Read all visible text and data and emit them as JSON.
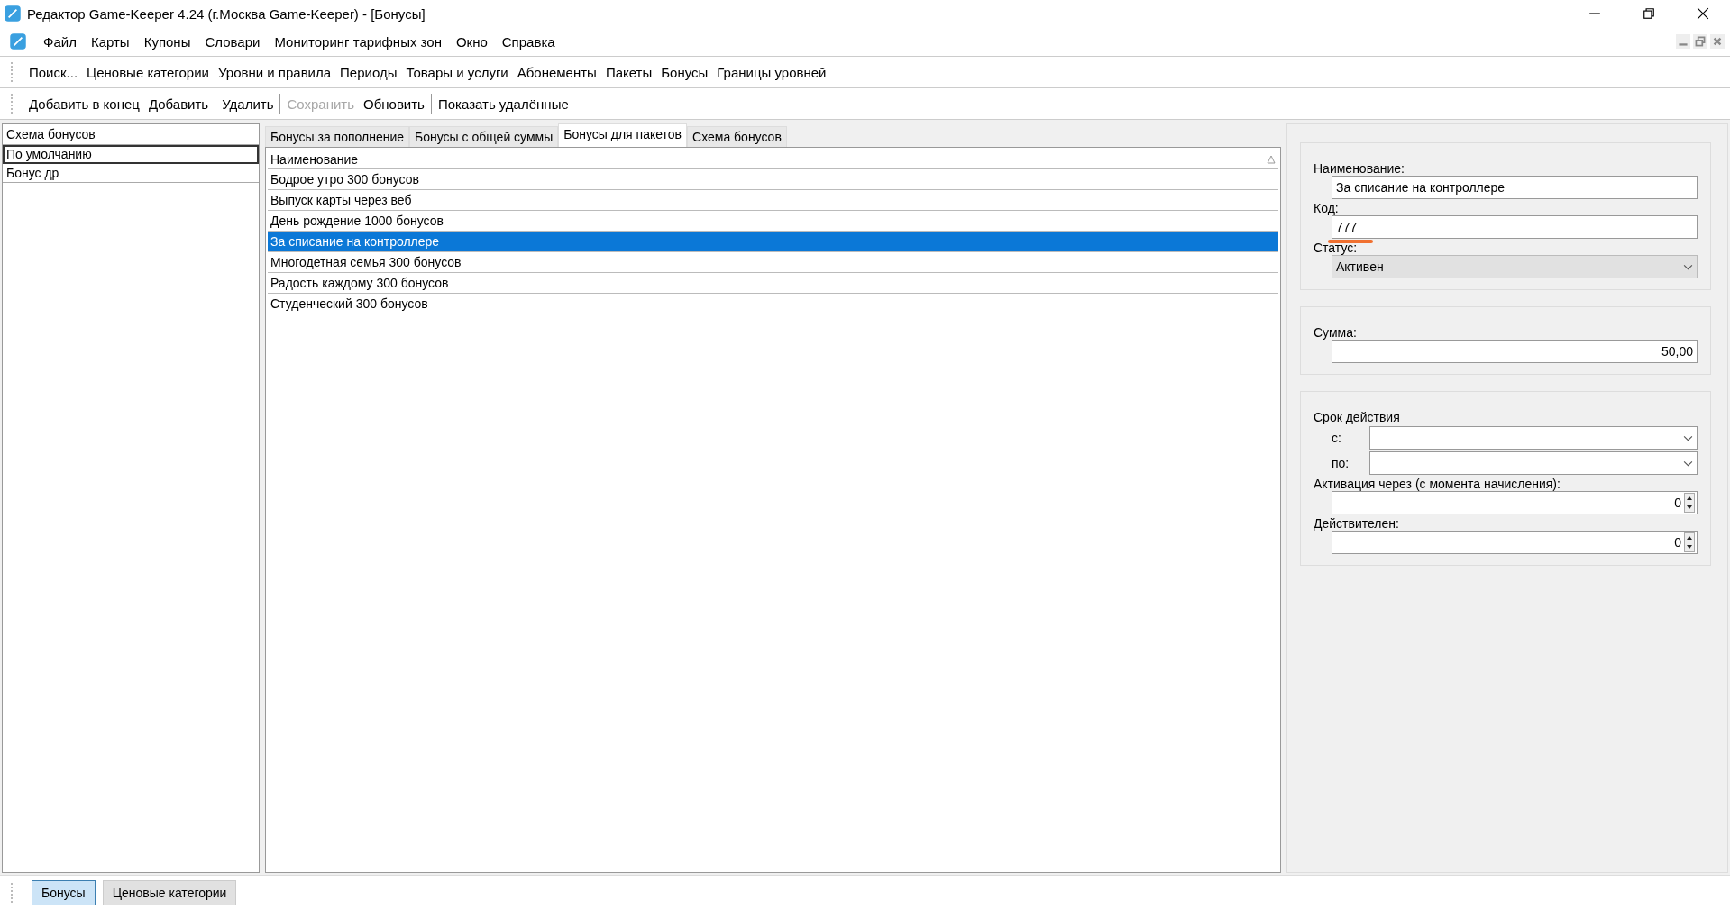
{
  "window": {
    "title": "Редактор Game-Keeper 4.24 (г.Москва Game-Keeper) - [Бонусы]"
  },
  "menu": [
    "Файл",
    "Карты",
    "Купоны",
    "Словари",
    "Мониторинг тарифных зон",
    "Окно",
    "Справка"
  ],
  "nav_toolbar": [
    "Поиск...",
    "Ценовые категории",
    "Уровни и правила",
    "Периоды",
    "Товары и услуги",
    "Абонементы",
    "Пакеты",
    "Бонусы",
    "Границы уровней"
  ],
  "action_toolbar": [
    {
      "label": "Добавить в конец",
      "disabled": false,
      "separator_after": false
    },
    {
      "label": "Добавить",
      "disabled": false,
      "separator_after": true
    },
    {
      "label": "Удалить",
      "disabled": false,
      "separator_after": true
    },
    {
      "label": "Сохранить",
      "disabled": true,
      "separator_after": false
    },
    {
      "label": "Обновить",
      "disabled": false,
      "separator_after": true
    },
    {
      "label": "Показать удалённые",
      "disabled": false,
      "separator_after": false
    }
  ],
  "schemes": {
    "header": "Схема бонусов",
    "items": [
      {
        "label": "По умолчанию",
        "selected": true
      },
      {
        "label": "Бонус др",
        "selected": false
      }
    ]
  },
  "tabs": [
    {
      "label": "Бонусы за пополнение",
      "selected": false
    },
    {
      "label": "Бонусы с общей суммы",
      "selected": false
    },
    {
      "label": "Бонусы для пакетов",
      "selected": true
    },
    {
      "label": "Схема бонусов",
      "selected": false
    }
  ],
  "table": {
    "columns": [
      "Наименование"
    ],
    "rows": [
      {
        "name": "Бодрое утро 300 бонусов",
        "selected": false
      },
      {
        "name": "Выпуск карты через веб",
        "selected": false
      },
      {
        "name": "День рождение 1000 бонусов",
        "selected": false
      },
      {
        "name": "За списание на контроллере",
        "selected": true
      },
      {
        "name": "Многодетная семья 300 бонусов",
        "selected": false
      },
      {
        "name": "Радость каждому 300 бонусов",
        "selected": false
      },
      {
        "name": "Студенческий 300 бонусов",
        "selected": false
      }
    ]
  },
  "form": {
    "name_label": "Наименование:",
    "name_value": "За списание на контроллере",
    "code_label": "Код:",
    "code_value": "777",
    "code_highlighted": true,
    "status_label": "Статус:",
    "status_value": "Активен",
    "sum_label": "Сумма:",
    "sum_value": "50,00",
    "validity_label": "Срок действия",
    "from_label": "с:",
    "to_label": "по:",
    "activation_label": "Активация через (с момента начисления):",
    "activation_value": "0",
    "valid_label": "Действителен:",
    "valid_value": "0"
  },
  "bottom_tabs": [
    {
      "label": "Бонусы",
      "selected": true
    },
    {
      "label": "Ценовые категории",
      "selected": false
    }
  ]
}
